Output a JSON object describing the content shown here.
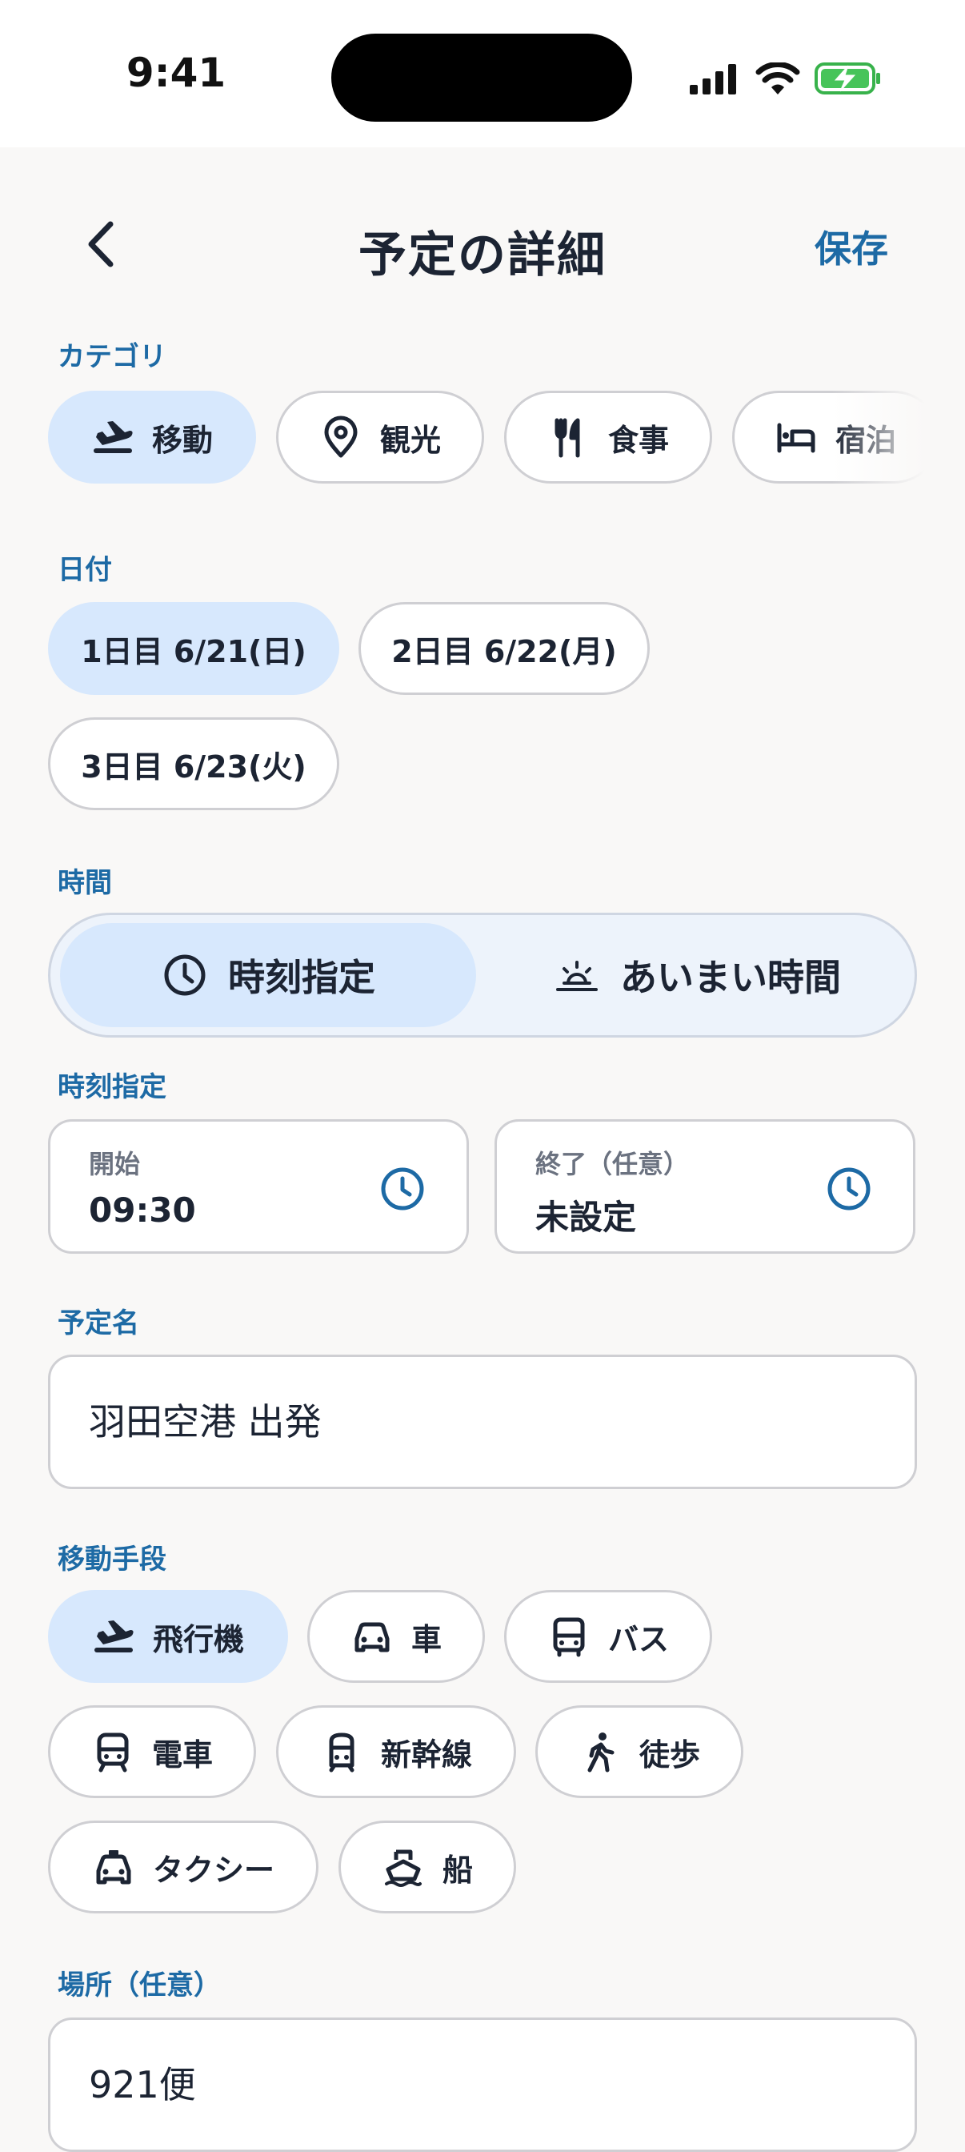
{
  "status_bar": {
    "time": "9:41"
  },
  "header": {
    "title": "予定の詳細",
    "save_label": "保存"
  },
  "category": {
    "label": "カテゴリ",
    "items": [
      {
        "label": "移動",
        "icon": "plane-icon",
        "selected": true
      },
      {
        "label": "観光",
        "icon": "map-pin-icon",
        "selected": false
      },
      {
        "label": "食事",
        "icon": "fork-knife-icon",
        "selected": false
      },
      {
        "label": "宿泊",
        "icon": "bed-icon",
        "selected": false
      }
    ]
  },
  "date": {
    "label": "日付",
    "items": [
      {
        "label": "1日目 6/21(日)",
        "selected": true
      },
      {
        "label": "2日目 6/22(月)",
        "selected": false
      },
      {
        "label": "3日目 6/23(火)",
        "selected": false
      }
    ]
  },
  "time": {
    "label": "時間",
    "options": [
      {
        "label": "時刻指定",
        "icon": "clock-icon",
        "selected": true
      },
      {
        "label": "あいまい時間",
        "icon": "sunrise-icon",
        "selected": false
      }
    ]
  },
  "time_spec": {
    "label": "時刻指定",
    "start": {
      "label": "開始",
      "value": "09:30"
    },
    "end": {
      "label": "終了（任意）",
      "value": "未設定"
    }
  },
  "name": {
    "label": "予定名",
    "value": "羽田空港 出発"
  },
  "transport": {
    "label": "移動手段",
    "items": [
      {
        "label": "飛行機",
        "icon": "plane-icon",
        "selected": true
      },
      {
        "label": "車",
        "icon": "car-icon",
        "selected": false
      },
      {
        "label": "バス",
        "icon": "bus-icon",
        "selected": false
      },
      {
        "label": "電車",
        "icon": "train-icon",
        "selected": false
      },
      {
        "label": "新幹線",
        "icon": "shinkansen-icon",
        "selected": false
      },
      {
        "label": "徒歩",
        "icon": "walk-icon",
        "selected": false
      },
      {
        "label": "タクシー",
        "icon": "taxi-icon",
        "selected": false
      },
      {
        "label": "船",
        "icon": "ship-icon",
        "selected": false
      }
    ]
  },
  "place": {
    "label": "場所（任意）",
    "value": "921便"
  },
  "colors": {
    "accent": "#1d6aa5",
    "selected_bg": "#d7e8fd",
    "border": "#cfcfd3",
    "background": "#f9f8f7"
  }
}
